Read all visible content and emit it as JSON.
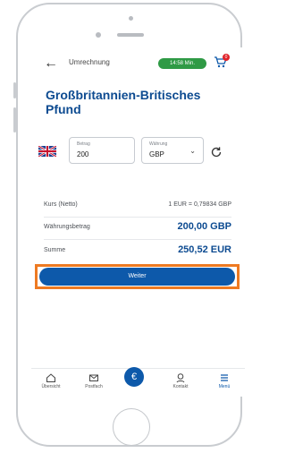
{
  "topbar": {
    "title": "Umrechnung",
    "timer": "14:58 Min.",
    "cart_count": "0"
  },
  "heading": {
    "line1": "Großbritannien-Britisches",
    "line2": "Pfund"
  },
  "form": {
    "amount_label": "Betrag",
    "amount_value": "200",
    "currency_label": "Währung",
    "currency_value": "GBP"
  },
  "summary": {
    "rate_label": "Kurs (Netto)",
    "rate_value": "1 EUR = 0,79834 GBP",
    "amount_label": "Währungsbetrag",
    "amount_value": "200,00 GBP",
    "total_label": "Summe",
    "total_value": "250,52 EUR"
  },
  "cta": {
    "label": "Weiter"
  },
  "nav": {
    "items": [
      {
        "label": "Übersicht",
        "icon": "home-icon"
      },
      {
        "label": "Postfach",
        "icon": "mail-icon"
      },
      {
        "label": "",
        "icon": "euro-icon"
      },
      {
        "label": "Kontakt",
        "icon": "contact-icon"
      },
      {
        "label": "Menü",
        "icon": "menu-icon"
      }
    ]
  },
  "colors": {
    "brand": "#0d59aa",
    "heading": "#0d4b91",
    "timer": "#2f9a45",
    "highlight": "#ee7a22",
    "badge": "#e0232a"
  }
}
